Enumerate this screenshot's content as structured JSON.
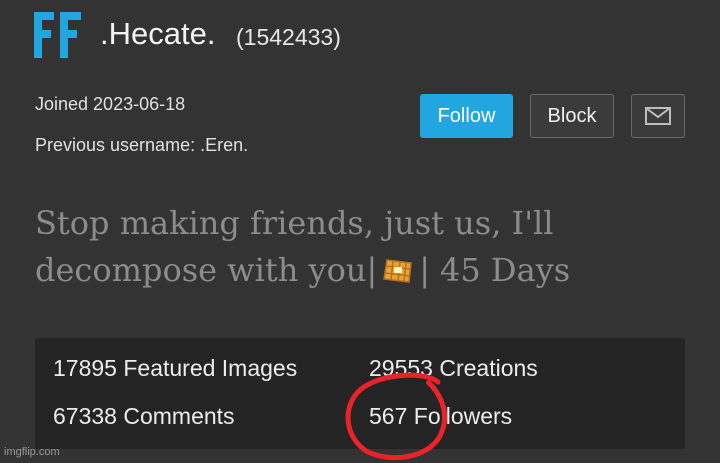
{
  "profile": {
    "avatar_text": "FF",
    "username": ".Hecate.",
    "user_id": "(1542433)",
    "joined": "Joined 2023-06-18",
    "previous_username": "Previous username: .Eren."
  },
  "actions": {
    "follow_label": "Follow",
    "block_label": "Block",
    "message_icon": "mail-icon"
  },
  "bio": {
    "line1": "Stop making friends, just us, I'll",
    "line2_prefix": "decompose with you",
    "sep_left": "|",
    "emoji": "waffle-icon",
    "sep_right": "|",
    "line2_suffix": "45 Days"
  },
  "stats": {
    "featured_images": "17895 Featured Images",
    "creations": "29553 Creations",
    "comments": "67338 Comments",
    "followers": "567 Followers"
  },
  "annotation": {
    "circle_color": "#e8232a"
  },
  "watermark": "imgflip.com",
  "colors": {
    "background": "#333333",
    "accent": "#21a6e0",
    "panel": "#242424"
  }
}
